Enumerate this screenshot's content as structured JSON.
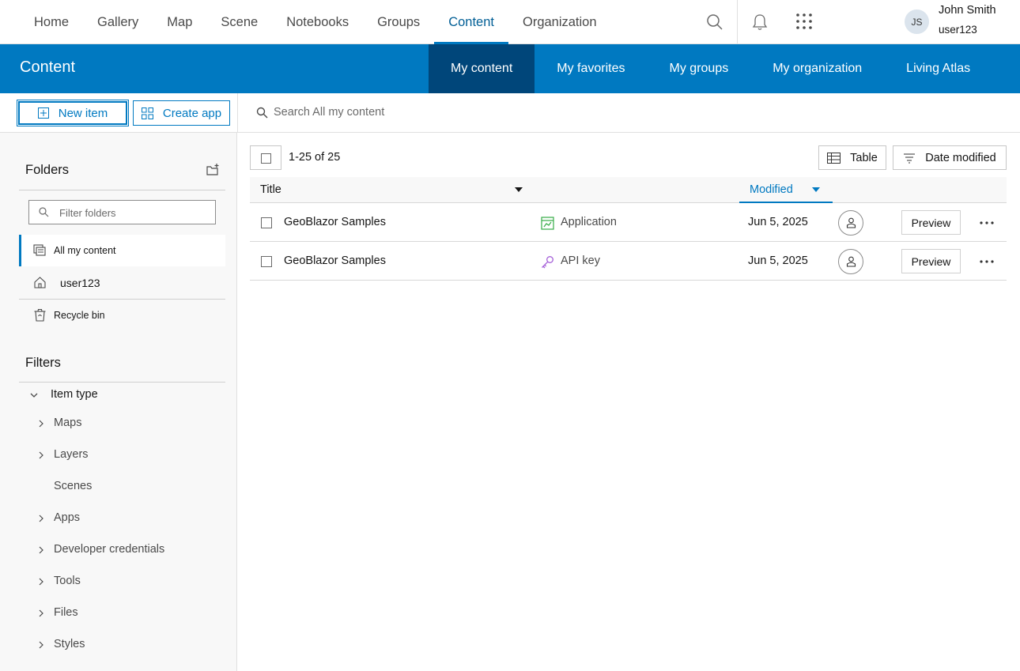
{
  "topnav": {
    "links": [
      "Home",
      "Gallery",
      "Map",
      "Scene",
      "Notebooks",
      "Groups",
      "Content",
      "Organization"
    ],
    "active": "Content",
    "icons": [
      "search-icon",
      "bell-icon",
      "apps-grid-icon"
    ],
    "user": {
      "initials": "JS",
      "name": "John Smith",
      "username": "user123"
    }
  },
  "band": {
    "title": "Content",
    "tabs": [
      "My content",
      "My favorites",
      "My groups",
      "My organization",
      "Living Atlas"
    ],
    "active_tab": "My content"
  },
  "toolbar": {
    "new_item": "New item",
    "create_app": "Create app",
    "search_placeholder": "Search All my content"
  },
  "sidebar": {
    "folders_title": "Folders",
    "filter_placeholder": "Filter folders",
    "folders": [
      {
        "label": "All my content",
        "icon": "all-content-icon",
        "active": true
      },
      {
        "label": "user123",
        "icon": "home-icon",
        "active": false
      },
      {
        "label": "Recycle bin",
        "icon": "recycle-bin-icon",
        "active": false
      }
    ],
    "filters_title": "Filters",
    "item_type_label": "Item type",
    "item_types": [
      {
        "label": "Maps",
        "expandable": true
      },
      {
        "label": "Layers",
        "expandable": true
      },
      {
        "label": "Scenes",
        "expandable": false
      },
      {
        "label": "Apps",
        "expandable": true
      },
      {
        "label": "Developer credentials",
        "expandable": true
      },
      {
        "label": "Tools",
        "expandable": true
      },
      {
        "label": "Files",
        "expandable": true
      },
      {
        "label": "Styles",
        "expandable": true
      }
    ]
  },
  "main": {
    "count": "1-25 of 25",
    "view_button": "Table",
    "sort_button": "Date modified",
    "columns": {
      "title": "Title",
      "modified": "Modified"
    },
    "rows": [
      {
        "title": "GeoBlazor Samples",
        "type": "Application",
        "type_icon": "application-icon",
        "type_color": "#35ac46",
        "modified": "Jun 5, 2025",
        "action": "Preview"
      },
      {
        "title": "GeoBlazor Samples",
        "type": "API key",
        "type_icon": "key-icon",
        "type_color": "#a560d8",
        "modified": "Jun 5, 2025",
        "action": "Preview"
      }
    ]
  },
  "colors": {
    "brand_blue": "#0079c1",
    "active_tab_dark": "#00467a"
  }
}
